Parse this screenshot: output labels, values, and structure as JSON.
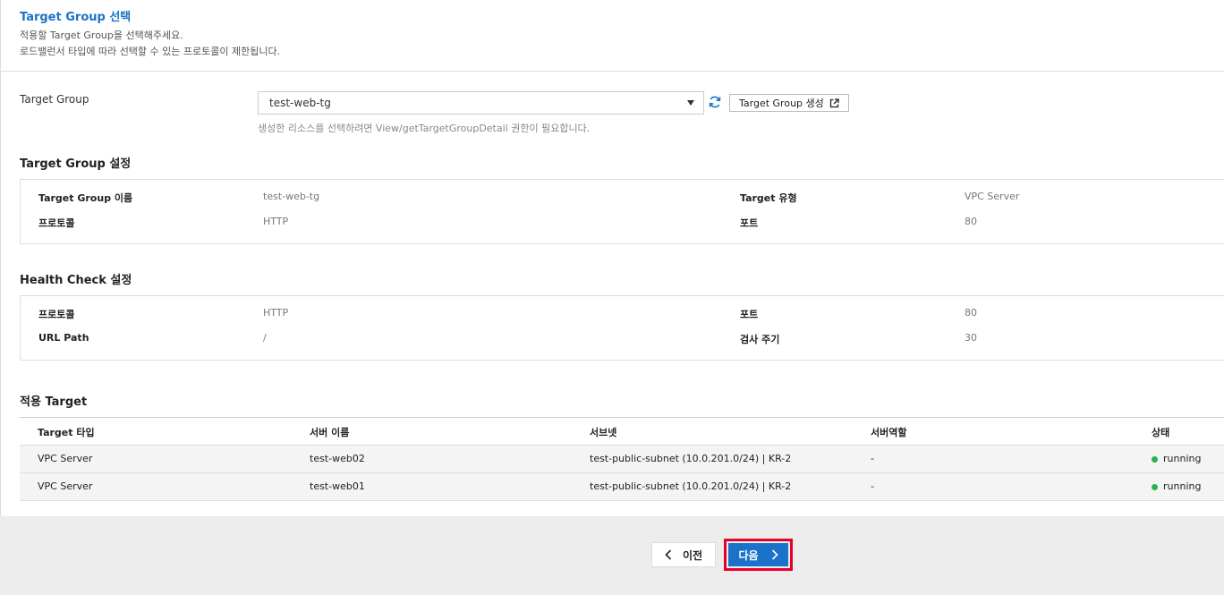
{
  "header": {
    "title": "Target Group 선택",
    "desc1": "적용할 Target Group을 선택해주세요.",
    "desc2": "로드밸런서 타입에 따라 선택할 수 있는 프로토콜이 제한됩니다."
  },
  "target_group": {
    "label": "Target Group",
    "selected": "test-web-tg",
    "create_label": "Target Group 생성",
    "hint": "생성한 리소스를 선택하려면 View/getTargetGroupDetail 권한이 필요합니다."
  },
  "tg_settings": {
    "title": "Target Group 설정",
    "name_label": "Target Group 이름",
    "name_value": "test-web-tg",
    "type_label": "Target 유형",
    "type_value": "VPC Server",
    "protocol_label": "프로토콜",
    "protocol_value": "HTTP",
    "port_label": "포트",
    "port_value": "80"
  },
  "health_check": {
    "title": "Health Check 설정",
    "protocol_label": "프로토콜",
    "protocol_value": "HTTP",
    "port_label": "포트",
    "port_value": "80",
    "path_label": "URL Path",
    "path_value": "/",
    "interval_label": "검사 주기",
    "interval_value": "30"
  },
  "targets": {
    "title": "적용 Target",
    "columns": [
      "Target 타입",
      "서버 이름",
      "서브넷",
      "서버역할",
      "상태"
    ],
    "rows": [
      [
        "VPC Server",
        "test-web02",
        "test-public-subnet (10.0.201.0/24) | KR-2",
        "-",
        "running"
      ],
      [
        "VPC Server",
        "test-web01",
        "test-public-subnet (10.0.201.0/24) | KR-2",
        "-",
        "running"
      ]
    ]
  },
  "footer": {
    "prev_label": "이전",
    "next_label": "다음"
  },
  "colors": {
    "accent": "#1a73c8",
    "highlight": "#e8002d",
    "status_running": "#2bb24c"
  }
}
